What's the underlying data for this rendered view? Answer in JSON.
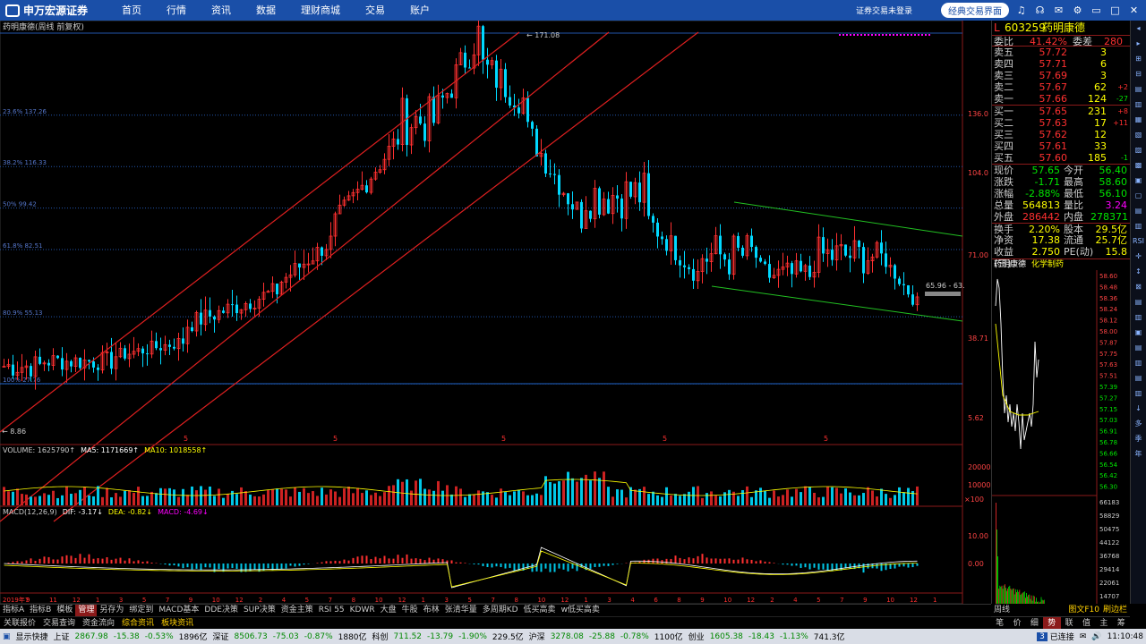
{
  "app": {
    "logo_text": "申万宏源证券",
    "logo_sub": "SHENWAN HONGYUAN SECURITIES",
    "nav": [
      "首页",
      "行情",
      "资讯",
      "数据",
      "理财商城",
      "交易",
      "账户"
    ],
    "login_text": "证券交易未登录",
    "classic_btn": "经典交易界面",
    "icons": [
      "bell-icon",
      "headset-icon",
      "mail-icon",
      "gear-icon",
      "minimize-icon",
      "maximize-icon",
      "close-icon"
    ]
  },
  "chart": {
    "title_tag": "药明康德(周线 前复权)",
    "top_label": "171.08",
    "bottom_label": "8.86",
    "fib_labels": [
      "23.6% 137.26",
      "38.2% 116.33",
      "50% 99.42",
      "61.8% 82.51",
      "80.9% 55.13",
      "100% 27.76"
    ],
    "y_labels": [
      "136.0",
      "104.0",
      "71.00",
      "38.71",
      "5.62"
    ],
    "range_tag": "65.96 - 63.",
    "x_markers": [
      "5",
      "5",
      "5",
      "5",
      "5"
    ],
    "colors": {
      "up": "#ff3030",
      "down": "#00d8ff",
      "channel": "#e02020",
      "trend": "#22c022",
      "fib": "#2255aa"
    }
  },
  "volume": {
    "header": [
      "VOLUME: 1625790↑",
      "MA5: 1171669↑",
      "MA10: 1018558↑"
    ],
    "y_labels": [
      "20000",
      "10000",
      "×100"
    ]
  },
  "macd": {
    "header": [
      "MACD(12,26,9)",
      "DIF: -3.17↓",
      "DEA: -0.82↓",
      "MACD: -4.69↓"
    ],
    "y_labels": [
      "10.00",
      "0.00"
    ]
  },
  "xaxis": [
    "2019年7",
    "9",
    "11",
    "12",
    "1",
    "3",
    "5",
    "7",
    "9",
    "10",
    "12",
    "2",
    "4",
    "5",
    "7",
    "8",
    "10",
    "12",
    "1",
    "3",
    "5",
    "7",
    "8",
    "10",
    "12",
    "1",
    "3",
    "4",
    "6",
    "8",
    "9",
    "10",
    "12",
    "2",
    "4",
    "5",
    "7",
    "9",
    "10",
    "12",
    "1"
  ],
  "bottom_tabs": [
    "指标A",
    "指标B",
    "模板",
    "管理",
    "另存为",
    "绑定到",
    "MACD基本",
    "DDE决策",
    "SUP决策",
    "资金主策",
    "RSI 55",
    "KDWR",
    "大盘",
    "牛股",
    "布林",
    "张清华量",
    "多周期KD",
    "低买高卖",
    "w低买高卖"
  ],
  "bottom_tabs_active": "管理",
  "bottom2": [
    "关联报价",
    "交易查询",
    "资金流向",
    "综合资讯",
    "板块资讯"
  ],
  "side_bottom": {
    "period": "周线",
    "buttons": [
      "图文F10",
      "刷边栏"
    ],
    "tabs": [
      "笔",
      "价",
      "细",
      "势",
      "联",
      "值",
      "主",
      "筹"
    ],
    "active": "势"
  },
  "quote": {
    "flag": "L",
    "code": "603259",
    "name": "药明康德",
    "weibi_label": "委比",
    "weibi": "41.42%",
    "weicha_label": "委差",
    "weicha": "280",
    "sell": [
      {
        "label": "卖五",
        "price": "57.72",
        "vol": "3",
        "chg": ""
      },
      {
        "label": "卖四",
        "price": "57.71",
        "vol": "6",
        "chg": ""
      },
      {
        "label": "卖三",
        "price": "57.69",
        "vol": "3",
        "chg": ""
      },
      {
        "label": "卖二",
        "price": "57.67",
        "vol": "62",
        "chg": "+2"
      },
      {
        "label": "卖一",
        "price": "57.66",
        "vol": "124",
        "chg": "-27"
      }
    ],
    "buy": [
      {
        "label": "买一",
        "price": "57.65",
        "vol": "231",
        "chg": "+8"
      },
      {
        "label": "买二",
        "price": "57.63",
        "vol": "17",
        "chg": "+11"
      },
      {
        "label": "买三",
        "price": "57.62",
        "vol": "12",
        "chg": ""
      },
      {
        "label": "买四",
        "price": "57.61",
        "vol": "33",
        "chg": ""
      },
      {
        "label": "买五",
        "price": "57.60",
        "vol": "185",
        "chg": "-1"
      }
    ],
    "stats": [
      {
        "k": "现价",
        "v": "57.65",
        "vc": "grn",
        "k2": "今开",
        "v2": "56.40",
        "v2c": "grn"
      },
      {
        "k": "涨跌",
        "v": "-1.71",
        "vc": "grn",
        "k2": "最高",
        "v2": "58.60",
        "v2c": "grn"
      },
      {
        "k": "涨幅",
        "v": "-2.88%",
        "vc": "grn",
        "k2": "最低",
        "v2": "56.10",
        "v2c": "grn"
      },
      {
        "k": "总量",
        "v": "564813",
        "vc": "yel",
        "k2": "量比",
        "v2": "3.24",
        "v2c": "mag"
      },
      {
        "k": "外盘",
        "v": "286442",
        "vc": "red",
        "k2": "内盘",
        "v2": "278371",
        "v2c": "grn"
      },
      {
        "k": "换手",
        "v": "2.20%",
        "vc": "yel",
        "k2": "股本",
        "v2": "29.5亿",
        "v2c": "yel"
      },
      {
        "k": "净资",
        "v": "17.38",
        "vc": "yel",
        "k2": "流通",
        "v2": "25.7亿",
        "v2c": "yel"
      },
      {
        "k": "收益(三)",
        "v": "2.750",
        "vc": "yel",
        "k2": "PE(动)",
        "v2": "15.8",
        "v2c": "yel"
      }
    ],
    "mini_title": "药明康德",
    "mini_sector": "化学制药",
    "mini_prices": [
      "58.60",
      "58.48",
      "58.36",
      "58.24",
      "58.12",
      "58.00",
      "57.87",
      "57.75",
      "57.63",
      "57.51",
      "57.39",
      "57.27",
      "57.15",
      "57.03",
      "56.91",
      "56.78",
      "56.66",
      "56.54",
      "56.42",
      "56.30"
    ],
    "mini_vols": [
      "66183",
      "58829",
      "50475",
      "44122",
      "36768",
      "29414",
      "22061",
      "14707",
      "7354"
    ]
  },
  "status": {
    "items": [
      {
        "t": "显示快捷",
        "c": ""
      },
      {
        "t": "上证",
        "c": ""
      },
      {
        "t": "2867.98",
        "c": "sgrn"
      },
      {
        "t": "-15.38",
        "c": "sgrn"
      },
      {
        "t": "-0.53%",
        "c": "sgrn"
      },
      {
        "t": "1896亿",
        "c": ""
      },
      {
        "t": "深证",
        "c": ""
      },
      {
        "t": "8506.73",
        "c": "sgrn"
      },
      {
        "t": "-75.03",
        "c": "sgrn"
      },
      {
        "t": "-0.87%",
        "c": "sgrn"
      },
      {
        "t": "1880亿",
        "c": ""
      },
      {
        "t": "科创",
        "c": ""
      },
      {
        "t": "711.52",
        "c": "sgrn"
      },
      {
        "t": "-13.79",
        "c": "sgrn"
      },
      {
        "t": "-1.90%",
        "c": "sgrn"
      },
      {
        "t": "229.5亿",
        "c": ""
      },
      {
        "t": "沪深",
        "c": ""
      },
      {
        "t": "3278.08",
        "c": "sgrn"
      },
      {
        "t": "-25.88",
        "c": "sgrn"
      },
      {
        "t": "-0.78%",
        "c": "sgrn"
      },
      {
        "t": "1100亿",
        "c": ""
      },
      {
        "t": "创业",
        "c": ""
      },
      {
        "t": "1605.38",
        "c": "sgrn"
      },
      {
        "t": "-18.43",
        "c": "sgrn"
      },
      {
        "t": "-1.13%",
        "c": "sgrn"
      },
      {
        "t": "741.3亿",
        "c": ""
      }
    ],
    "connected": "已连接",
    "conn_num": "3",
    "time": "11:10:48"
  },
  "right_tools": [
    "◂",
    "▸",
    "⊞",
    "⊟",
    "▤",
    "▥",
    "▦",
    "▧",
    "▨",
    "▩",
    "▣",
    "▢",
    "▤",
    "▥",
    "RSI",
    "✛",
    "↕",
    "⊠",
    "▤",
    "▥",
    "▣",
    "▤",
    "▥",
    "▤",
    "▥",
    "↓",
    "多",
    "季",
    "年"
  ]
}
